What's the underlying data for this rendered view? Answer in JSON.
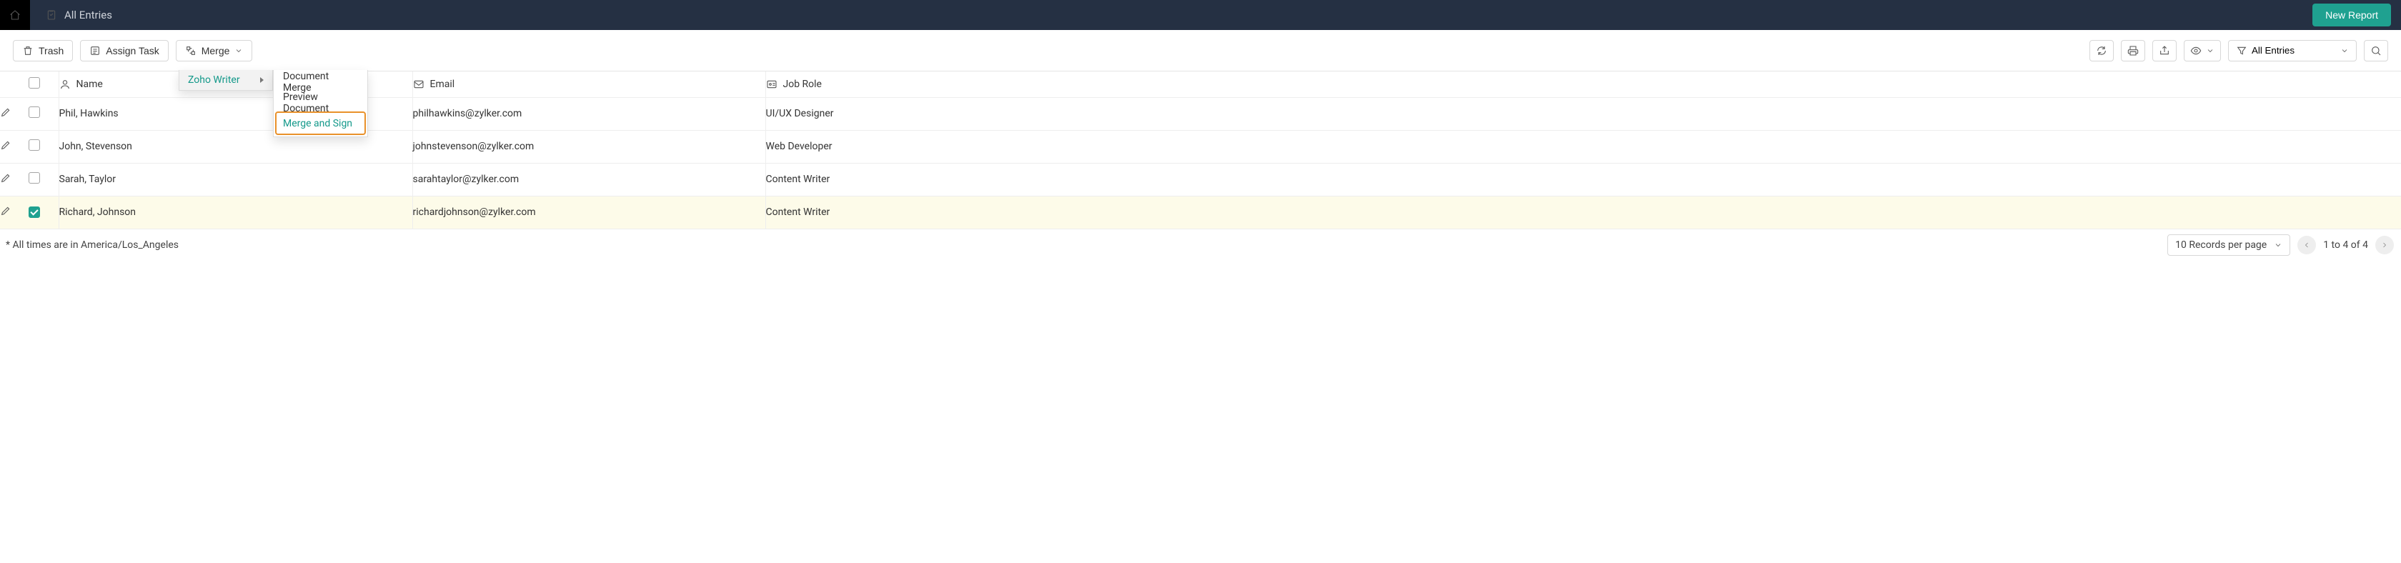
{
  "header": {
    "title": "All Entries",
    "new_report": "New Report"
  },
  "toolbar": {
    "trash": "Trash",
    "assign_task": "Assign Task",
    "merge": "Merge",
    "filter_label": "All Entries"
  },
  "merge_menu": {
    "root": "Zoho Writer",
    "items": [
      "Document Merge",
      "Preview Document",
      "Merge and Sign"
    ],
    "highlight_index": 2
  },
  "columns": {
    "name": "Name",
    "email": "Email",
    "role": "Job Role"
  },
  "rows": [
    {
      "name": "Phil, Hawkins",
      "email": "philhawkins@zylker.com",
      "role": "UI/UX Designer",
      "checked": false
    },
    {
      "name": "John, Stevenson",
      "email": "johnstevenson@zylker.com",
      "role": "Web Developer",
      "checked": false
    },
    {
      "name": "Sarah, Taylor",
      "email": "sarahtaylor@zylker.com",
      "role": "Content Writer",
      "checked": false
    },
    {
      "name": "Richard, Johnson",
      "email": "richardjohnson@zylker.com",
      "role": "Content Writer",
      "checked": true
    }
  ],
  "footer": {
    "timezone_note": "* All times are in America/Los_Angeles",
    "page_size_label": "10 Records per page",
    "range": "1 to 4 of 4"
  }
}
